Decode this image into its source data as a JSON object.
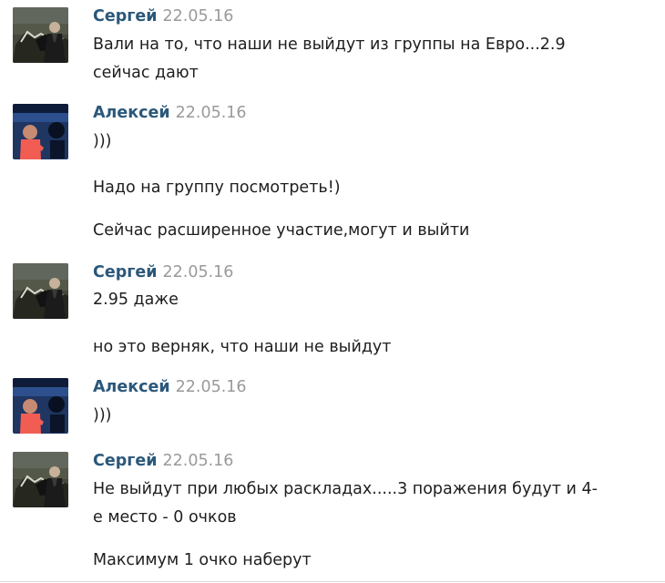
{
  "messages": [
    {
      "author": "Сергей",
      "date": "22.05.16",
      "avatar": "sergey-avatar",
      "lines": [
        "Вали на то, что наши не выйдут из группы на Евро...2.9",
        "сейчас дают"
      ]
    },
    {
      "author": "Алексей",
      "date": "22.05.16",
      "avatar": "alexey-avatar",
      "lines": [
        ")))"
      ]
    },
    {
      "author": "Алексей",
      "date": "22.05.16",
      "avatar": "alexey-avatar",
      "lines": [
        "Надо на группу посмотреть!)"
      ]
    },
    {
      "author": "Алексей",
      "date": "22.05.16",
      "avatar": "alexey-avatar",
      "lines": [
        "Сейчас расширенное участие,могут и выйти"
      ]
    },
    {
      "author": "Сергей",
      "date": "22.05.16",
      "avatar": "sergey-avatar",
      "lines": [
        "2.95 даже"
      ]
    },
    {
      "author": "Сергей",
      "date": "22.05.16",
      "avatar": "sergey-avatar",
      "lines": [
        "но это верняк, что наши не выйдут"
      ]
    },
    {
      "author": "Алексей",
      "date": "22.05.16",
      "avatar": "alexey-avatar",
      "lines": [
        ")))"
      ]
    },
    {
      "author": "Сергей",
      "date": "22.05.16",
      "avatar": "sergey-avatar",
      "lines": [
        "Не выйдут при любых раскладах.....3 поражения будут и 4-",
        "е место - 0 очков"
      ]
    },
    {
      "author": "Сергей",
      "date": "22.05.16",
      "avatar": "sergey-avatar",
      "lines": [
        "Максимум 1 очко наберут"
      ]
    }
  ]
}
